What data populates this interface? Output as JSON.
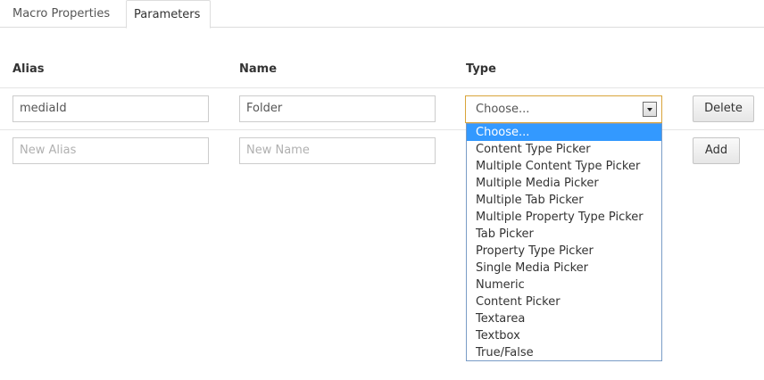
{
  "tabs": [
    {
      "label": "Macro Properties",
      "active": false
    },
    {
      "label": "Parameters",
      "active": true
    }
  ],
  "columns": {
    "alias": "Alias",
    "name": "Name",
    "type": "Type"
  },
  "row": {
    "alias_value": "mediaId",
    "name_value": "Folder",
    "type_value": "Choose...",
    "delete_label": "Delete"
  },
  "new_row": {
    "alias_placeholder": "New Alias",
    "name_placeholder": "New Name",
    "add_label": "Add"
  },
  "type_dropdown": {
    "open": true,
    "selected": "Choose...",
    "options": [
      "Choose...",
      "Content Type Picker",
      "Multiple Content Type Picker",
      "Multiple Media Picker",
      "Multiple Tab Picker",
      "Multiple Property Type Picker",
      "Tab Picker",
      "Property Type Picker",
      "Single Media Picker",
      "Numeric",
      "Content Picker",
      "Textarea",
      "Textbox",
      "True/False"
    ]
  },
  "colors": {
    "selected_option": "#3399ff",
    "select_focus_border": "#d9a43a",
    "dropdown_border": "#7a9cc6"
  },
  "icons": {
    "select_arrow": "chevron-down-icon"
  }
}
